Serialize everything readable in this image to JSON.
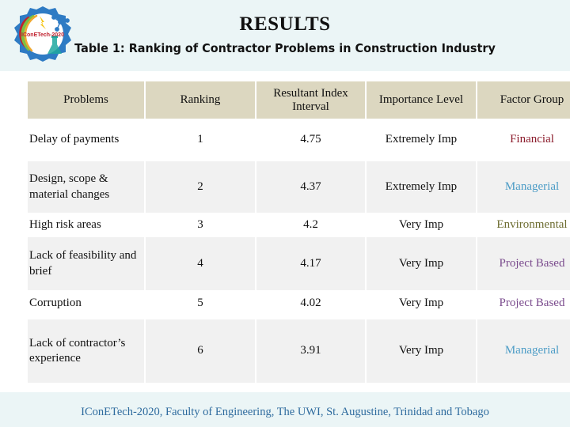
{
  "slide": {
    "title": "RESULTS",
    "caption": "Table 1: Ranking of Contractor Problems in Construction Industry",
    "footer": "IConETech-2020, Faculty of Engineering, The UWI, St. Augustine, Trinidad and Tobago",
    "background": "#FFFFFF",
    "band_color": "#EBF5F6"
  },
  "logo": {
    "name": "iconetech-2020-logo",
    "inner_text": "IConETech-2020",
    "gear_color": "#2E7BC4",
    "ring_color": "#C0212E",
    "accent_green": "#7BC043",
    "flask_color": "#1FA8A0"
  },
  "table": {
    "header_bg": "#DCD7C0",
    "row_white_bg": "#FFFFFF",
    "row_gray_bg": "#F1F1F1",
    "columns": [
      "Problems",
      "Ranking",
      "Resultant Index Interval",
      "Importance Level",
      "Factor Group"
    ],
    "rows": [
      {
        "problem": "Delay of payments",
        "ranking": "1",
        "resultant_index_interval": "4.75",
        "importance_level": "Extremely Imp",
        "factor_group": "Financial",
        "factor_color": "#8C1D2D",
        "shade": "white"
      },
      {
        "problem": "Design, scope & material changes",
        "ranking": "2",
        "resultant_index_interval": "4.37",
        "importance_level": "Extremely Imp",
        "factor_group": "Managerial",
        "factor_color": "#4C9CC6",
        "shade": "gray"
      },
      {
        "problem": "High risk areas",
        "ranking": "3",
        "resultant_index_interval": "4.2",
        "importance_level": "Very Imp",
        "factor_group": "Environmental",
        "factor_color": "#6D6C30",
        "shade": "white"
      },
      {
        "problem": "Lack of feasibility and brief",
        "ranking": "4",
        "resultant_index_interval": "4.17",
        "importance_level": "Very Imp",
        "factor_group": "Project Based",
        "factor_color": "#7A4B8D",
        "shade": "gray"
      },
      {
        "problem": "Corruption",
        "ranking": "5",
        "resultant_index_interval": "4.02",
        "importance_level": "Very Imp",
        "factor_group": "Project Based",
        "factor_color": "#7A4B8D",
        "shade": "white"
      },
      {
        "problem": "Lack of contractor’s experience",
        "ranking": "6",
        "resultant_index_interval": "3.91",
        "importance_level": "Very Imp",
        "factor_group": "Managerial",
        "factor_color": "#4C9CC6",
        "shade": "gray"
      }
    ]
  }
}
